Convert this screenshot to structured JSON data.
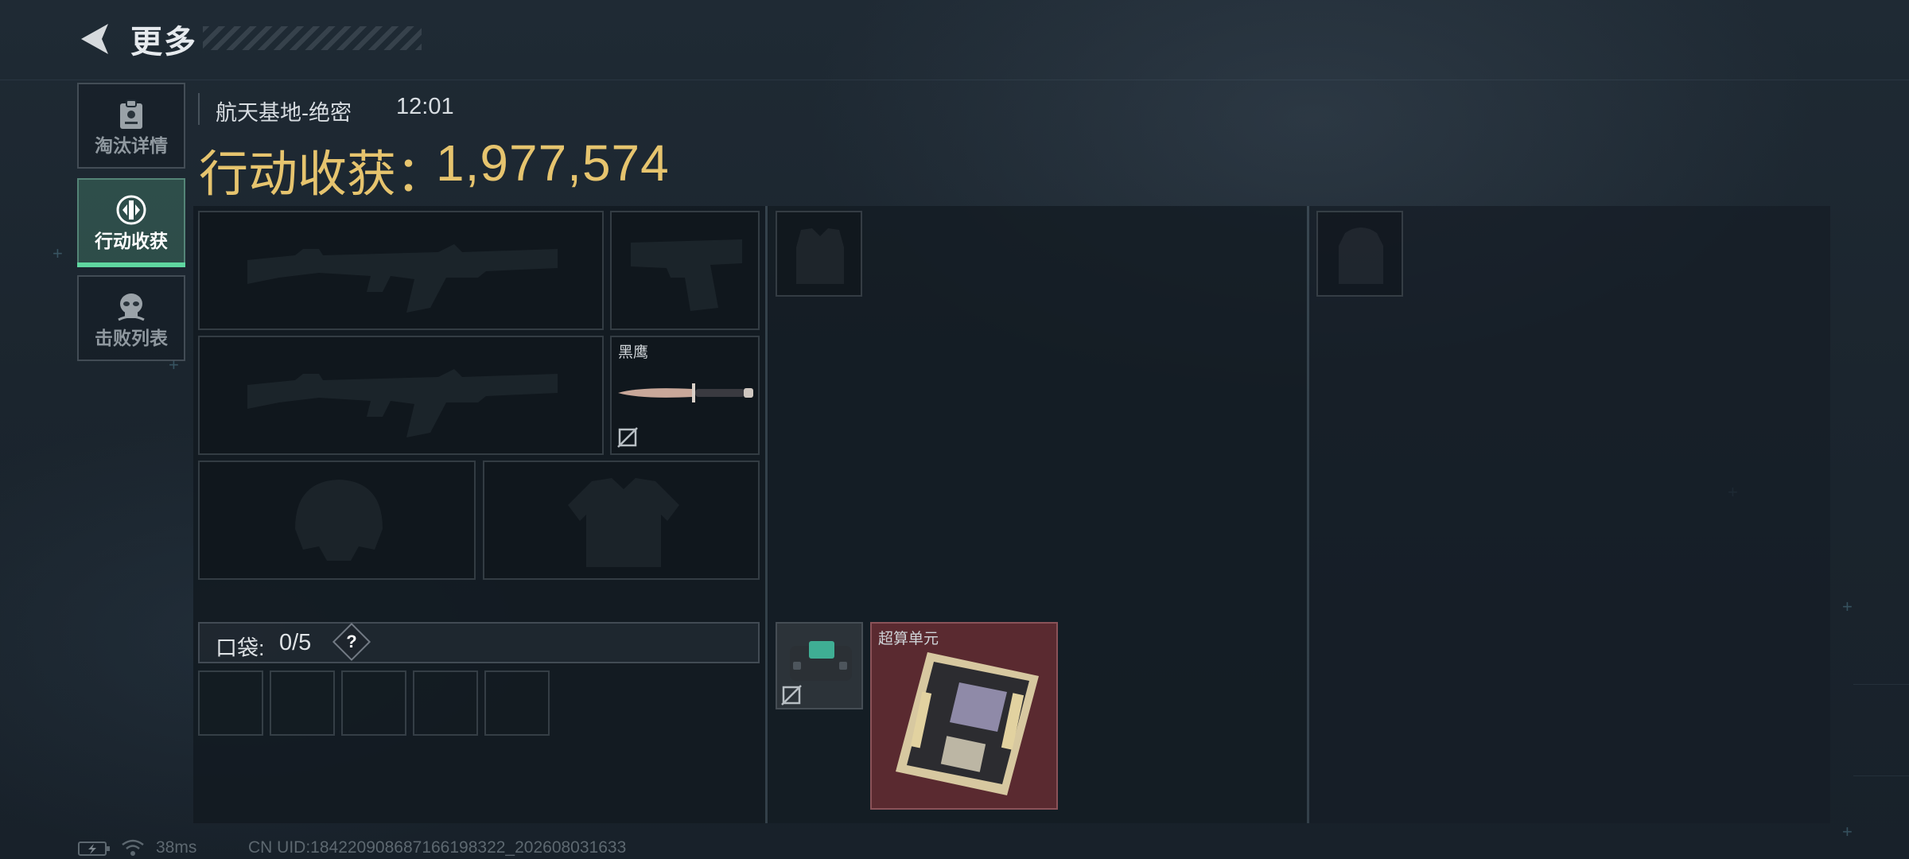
{
  "header": {
    "title": "更多",
    "back_icon": "back-arrow-icon"
  },
  "nav": {
    "items": [
      {
        "label": "淘汰详情",
        "icon": "clipboard-icon",
        "active": false
      },
      {
        "label": "行动收获",
        "icon": "loot-emblem-icon",
        "active": true
      },
      {
        "label": "击败列表",
        "icon": "skull-icon",
        "active": false
      }
    ]
  },
  "match": {
    "map": "航天基地-绝密",
    "time": "12:01"
  },
  "haul": {
    "label": "行动收获：",
    "value": "1,977,574"
  },
  "equipment": {
    "melee_name": "黑鹰",
    "pocket": {
      "label": "口袋:",
      "count": "0/5",
      "help": "?"
    }
  },
  "loot": {
    "item_name": "超算单元"
  },
  "status": {
    "latency": "38ms",
    "uid": "CN UID:18422090868716619832​2_202608031633"
  },
  "colors": {
    "accent": "#5fd6a0",
    "gold": "#e6c46e",
    "loot_bg": "#5a2a30"
  }
}
